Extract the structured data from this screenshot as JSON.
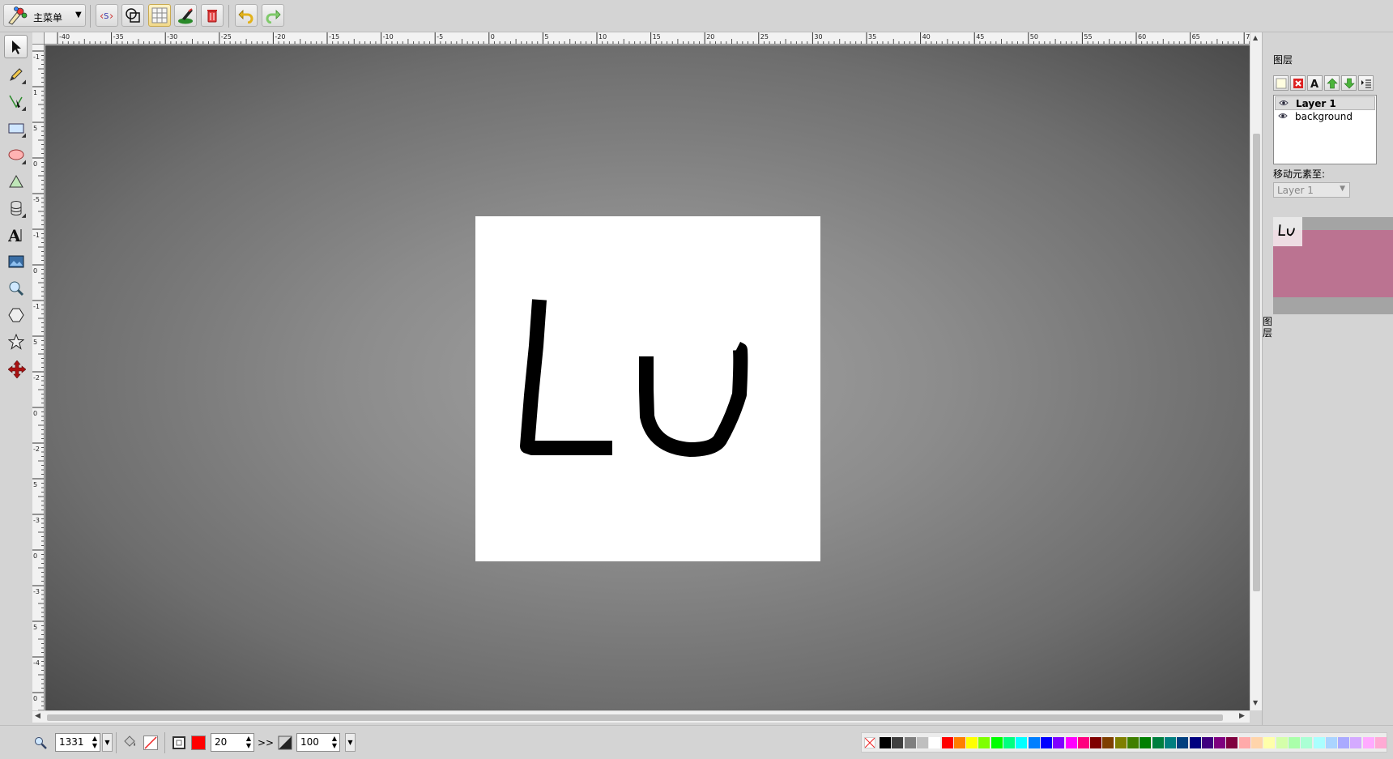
{
  "main_menu": {
    "label": "主菜单"
  },
  "top_tools": [
    {
      "name": "source-button",
      "icon": "source-icon"
    },
    {
      "name": "wireframe-button",
      "icon": "wireframe-icon"
    },
    {
      "name": "grid-toggle-button",
      "icon": "grid-icon"
    },
    {
      "name": "edit-canvas-button",
      "icon": "canvas-edit-icon"
    },
    {
      "name": "clear-button",
      "icon": "trash-icon"
    },
    {
      "name": "undo-button",
      "icon": "undo-icon"
    },
    {
      "name": "redo-button",
      "icon": "redo-icon"
    }
  ],
  "left_tools": [
    "select-tool",
    "pencil-tool",
    "pen-tool",
    "rectangle-tool",
    "ellipse-tool",
    "path-tool",
    "shapelib-tool",
    "text-tool",
    "image-tool",
    "zoom-tool",
    "polygon-tool",
    "star-tool",
    "arrows-tool"
  ],
  "ruler": {
    "top_labels": [
      "-40",
      "-35",
      "-30",
      "-25",
      "-20",
      "-15",
      "-10",
      "-5",
      "0",
      "5",
      "10",
      "15",
      "20",
      "25",
      "30",
      "35",
      "40",
      "45",
      "50",
      "55",
      "60",
      "65",
      "70"
    ],
    "left_labels": [
      "-1",
      "1",
      "5",
      "0",
      "-5",
      "-1",
      "0",
      "-1",
      "5",
      "-2",
      "0",
      "-2",
      "5",
      "-3",
      "0",
      "-3",
      "5",
      "-4",
      "0"
    ]
  },
  "canvas": {
    "drawing_text": "Lu",
    "stroke_color": "#000000",
    "background": "#ffffff"
  },
  "layers_panel": {
    "title": "图层",
    "tab_label": "图层",
    "layers": [
      {
        "name": "Layer 1",
        "selected": true
      },
      {
        "name": "background",
        "selected": false
      }
    ],
    "move_label": "移动元素至:",
    "move_select_value": "Layer 1"
  },
  "bottom": {
    "zoom_value": "1331",
    "stroke_width": "20",
    "stroke_more": ">>",
    "opacity_value": "100",
    "fill_color": "none",
    "stroke_color": "#ff0000"
  },
  "palette": [
    "#000000",
    "#3f3f3f",
    "#7f7f7f",
    "#bfbfbf",
    "#ffffff",
    "#ff0000",
    "#ff7f00",
    "#ffff00",
    "#7fff00",
    "#00ff00",
    "#00ff7f",
    "#00ffff",
    "#007fff",
    "#0000ff",
    "#7f00ff",
    "#ff00ff",
    "#ff007f",
    "#7f0000",
    "#7f3f00",
    "#7f7f00",
    "#3f7f00",
    "#007f00",
    "#007f3f",
    "#007f7f",
    "#003f7f",
    "#00007f",
    "#3f007f",
    "#7f007f",
    "#7f003f",
    "#ffaaaa",
    "#ffd4aa",
    "#ffffaa",
    "#d4ffaa",
    "#aaffaa",
    "#aaffd4",
    "#aaffff",
    "#aad4ff",
    "#aaaaff",
    "#d4aaff",
    "#ffaaff",
    "#ffaad4"
  ]
}
